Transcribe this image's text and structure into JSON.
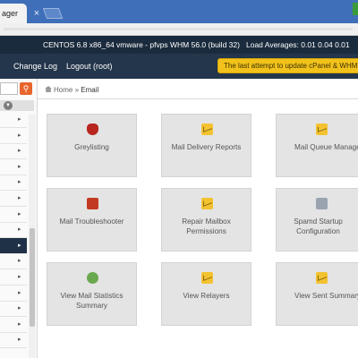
{
  "browser": {
    "tab_title": "ager",
    "tab_close": "×"
  },
  "topbar": {
    "os": "CENTOS 6.8 x86_64 vmware - pfvps",
    "whm": "WHM 56.0 (build 32)",
    "load": "Load Averages: 0.01 0.04 0.01"
  },
  "nav": {
    "items": [
      "Change Log",
      "Logout (root)"
    ],
    "alert": "The last attempt to update cPanel & WHM f"
  },
  "sidebar": {
    "search_icon": "search-icon",
    "collapse_icon": "chevron-down-icon",
    "item_arrow": "▸"
  },
  "breadcrumb": {
    "home": "Home",
    "separator": "»",
    "current": "Email"
  },
  "tiles": [
    {
      "label": "Greylisting",
      "icon": "shield-icon"
    },
    {
      "label": "Mail Delivery Reports",
      "icon": "search-envelope-icon"
    },
    {
      "label": "Mail Queue Manage",
      "icon": "envelope-queue-icon"
    },
    {
      "label": "Mail Troubleshooter",
      "icon": "toolbox-icon"
    },
    {
      "label": "Repair Mailbox Permissions",
      "icon": "envelope-repair-icon"
    },
    {
      "label": "Spamd Startup Configuration",
      "icon": "document-icon"
    },
    {
      "label": "View Mail Statistics Summary",
      "icon": "statistics-icon"
    },
    {
      "label": "View Relayers",
      "icon": "envelope-icon"
    },
    {
      "label": "View Sent Summary",
      "icon": "envelope-sent-icon"
    }
  ],
  "colors": {
    "topbar": "#1a2b3d",
    "navbar": "#24364b",
    "alert": "#f2c21b",
    "tile": "#e4e4e4",
    "search_button": "#e8652c"
  }
}
